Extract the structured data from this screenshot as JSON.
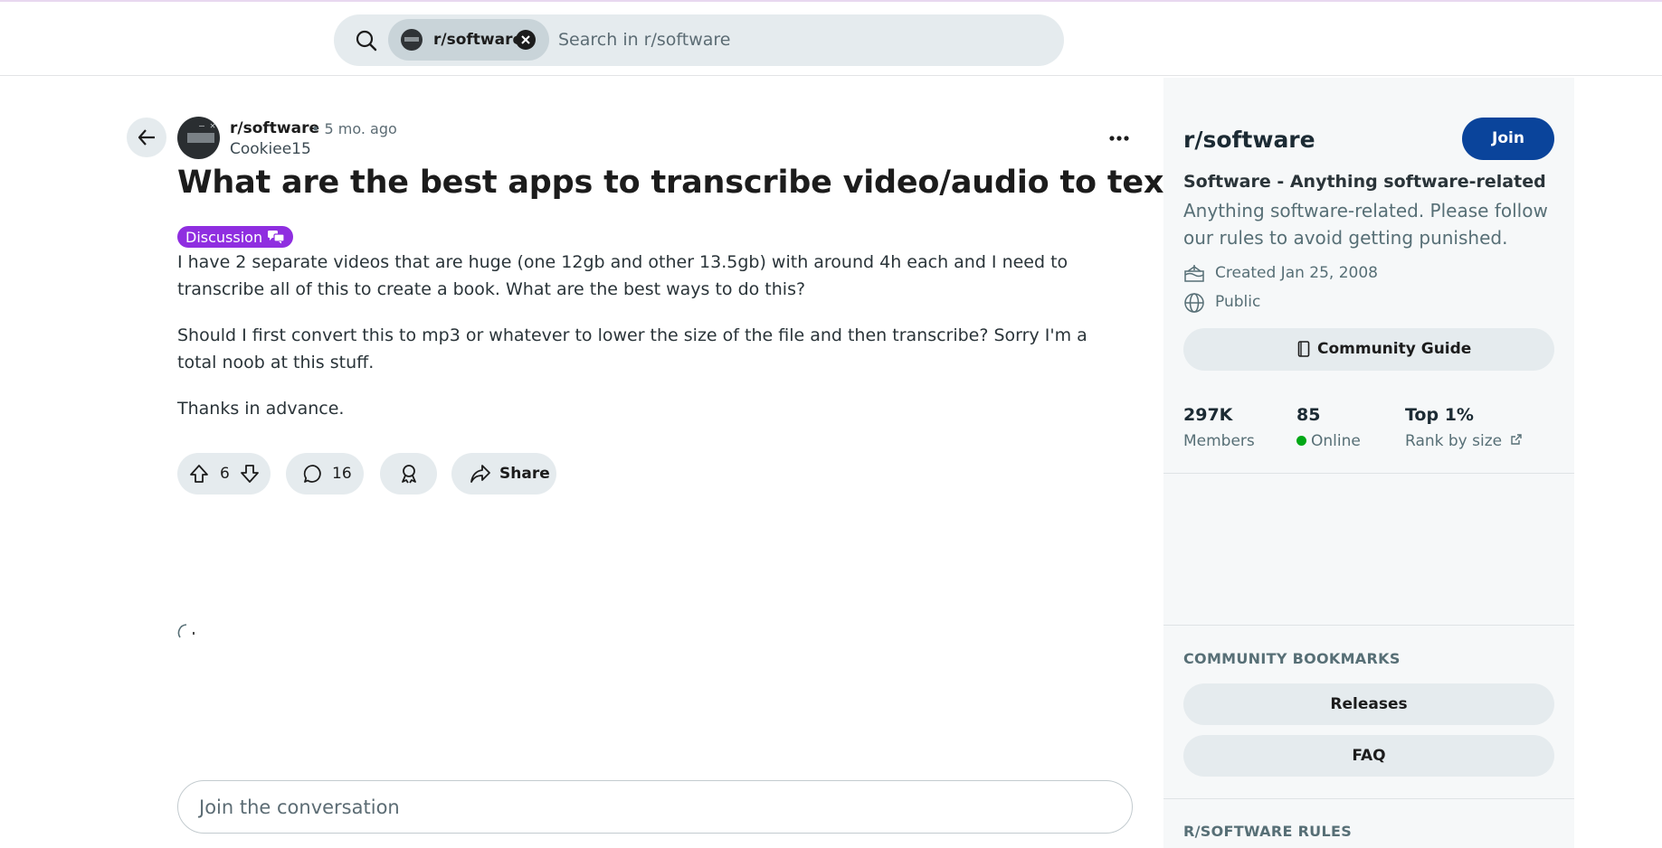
{
  "search": {
    "chip_label": "r/software",
    "placeholder": "Search in r/software"
  },
  "post": {
    "subreddit": "r/software",
    "time": "• 5 mo. ago",
    "author": "Cookiee15",
    "title": "What are the best apps to transcribe video/audio to text?",
    "flair": "Discussion",
    "paragraphs": [
      "I have 2 separate videos that are huge (one 12gb and other 13.5gb) with around 4h each and I need to transcribe all of this to create a book. What are the best ways to do this?",
      "Should I first convert this to mp3 or whatever to lower the size of the file and then transcribe? Sorry I'm a total noob at this stuff.",
      "Thanks in advance."
    ],
    "votes": "6",
    "comments": "16",
    "share_label": "Share"
  },
  "composer": {
    "placeholder": "Join the conversation"
  },
  "sidebar": {
    "title": "r/software",
    "join_label": "Join",
    "headline": "Software - Anything software-related",
    "description": "Anything software-related. Please follow our rules to avoid getting punished.",
    "created": "Created Jan 25, 2008",
    "visibility": "Public",
    "guide_label": "Community Guide",
    "stats": [
      {
        "value": "297K",
        "label": "Members"
      },
      {
        "value": "85",
        "label": "Online"
      },
      {
        "value": "Top 1%",
        "label": "Rank by size"
      }
    ],
    "bookmarks_title": "COMMUNITY BOOKMARKS",
    "bookmarks": [
      "Releases",
      "FAQ"
    ],
    "rules_title": "R/SOFTWARE RULES"
  },
  "colors": {
    "join_button": "#0a449b",
    "flair": "#8f2ee0",
    "online_dot": "#01a816"
  }
}
